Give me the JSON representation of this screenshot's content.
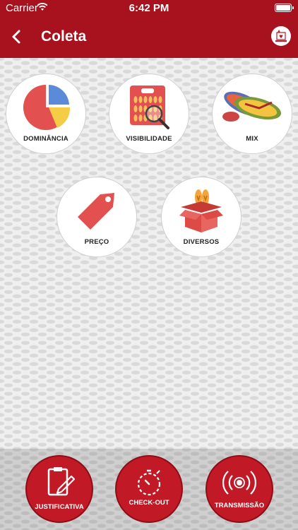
{
  "status_bar": {
    "carrier": "Carrier",
    "time": "6:42 PM"
  },
  "header": {
    "title": "Coleta",
    "back_icon": "chevron-left-icon",
    "logo_icon": "loja-logo-icon"
  },
  "tiles": [
    {
      "label": "DOMINÂNCIA",
      "icon": "pie-chart-icon"
    },
    {
      "label": "VISIBILIDADE",
      "icon": "display-magnifier-icon"
    },
    {
      "label": "MIX",
      "icon": "flip-flops-icon"
    },
    {
      "label": "PREÇO",
      "icon": "price-tag-icon"
    },
    {
      "label": "DIVERSOS",
      "icon": "box-icon"
    }
  ],
  "footer": [
    {
      "label": "JUSTIFICATIVA",
      "icon": "clipboard-icon"
    },
    {
      "label": "CHECK-OUT",
      "icon": "timer-icon"
    },
    {
      "label": "TRANSMISSÃO",
      "icon": "broadcast-icon"
    }
  ],
  "colors": {
    "brand": "#a8121f",
    "button": "#c21926",
    "tag": "#e2514f",
    "box": "#dd4b46"
  }
}
